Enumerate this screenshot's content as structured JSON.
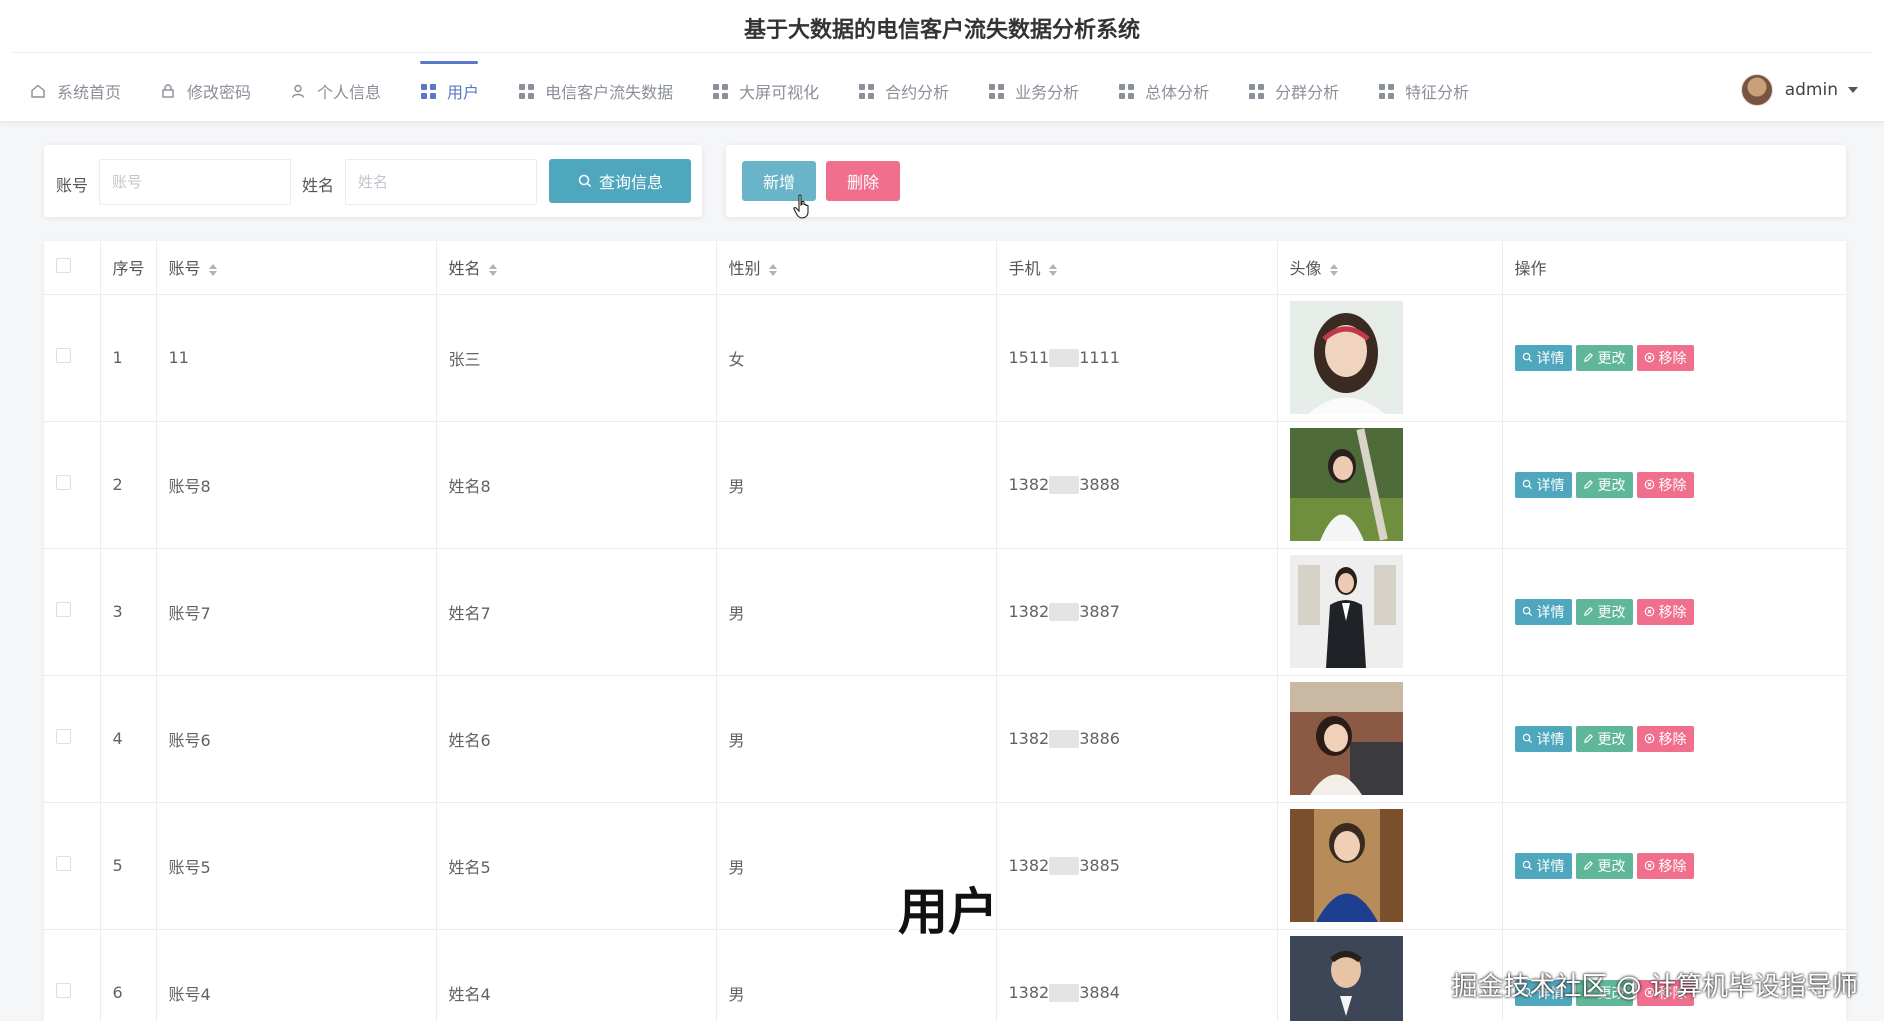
{
  "header": {
    "title": "基于大数据的电信客户流失数据分析系统",
    "user": "admin"
  },
  "nav": [
    {
      "label": "系统首页",
      "icon": "home-icon"
    },
    {
      "label": "修改密码",
      "icon": "lock-icon"
    },
    {
      "label": "个人信息",
      "icon": "user-icon"
    },
    {
      "label": "用户",
      "icon": "grid-icon",
      "active": true
    },
    {
      "label": "电信客户流失数据",
      "icon": "grid-icon"
    },
    {
      "label": "大屏可视化",
      "icon": "grid-icon"
    },
    {
      "label": "合约分析",
      "icon": "grid-icon"
    },
    {
      "label": "业务分析",
      "icon": "grid-icon"
    },
    {
      "label": "总体分析",
      "icon": "grid-icon"
    },
    {
      "label": "分群分析",
      "icon": "grid-icon"
    },
    {
      "label": "特征分析",
      "icon": "grid-icon"
    }
  ],
  "search": {
    "account_label": "账号",
    "account_placeholder": "账号",
    "name_label": "姓名",
    "name_placeholder": "姓名",
    "query_button": "查询信息"
  },
  "actions": {
    "add_button": "新增",
    "delete_button": "删除"
  },
  "table": {
    "columns": [
      "序号",
      "账号",
      "姓名",
      "性别",
      "手机",
      "头像",
      "操作"
    ],
    "row_actions": {
      "detail": "详情",
      "edit": "更改",
      "remove": "移除"
    },
    "rows": [
      {
        "index": "1",
        "account": "11",
        "name": "张三",
        "gender": "女",
        "phone_prefix": "1511",
        "phone_suffix": "1111"
      },
      {
        "index": "2",
        "account": "账号8",
        "name": "姓名8",
        "gender": "男",
        "phone_prefix": "1382",
        "phone_suffix": "3888"
      },
      {
        "index": "3",
        "account": "账号7",
        "name": "姓名7",
        "gender": "男",
        "phone_prefix": "1382",
        "phone_suffix": "3887"
      },
      {
        "index": "4",
        "account": "账号6",
        "name": "姓名6",
        "gender": "男",
        "phone_prefix": "1382",
        "phone_suffix": "3886"
      },
      {
        "index": "5",
        "account": "账号5",
        "name": "姓名5",
        "gender": "男",
        "phone_prefix": "1382",
        "phone_suffix": "3885"
      },
      {
        "index": "6",
        "account": "账号4",
        "name": "姓名4",
        "gender": "男",
        "phone_prefix": "1382",
        "phone_suffix": "3884"
      }
    ]
  },
  "overlay": {
    "caption": "用户",
    "watermark": "掘金技术社区 @ 计算机毕设指导师"
  },
  "colors": {
    "accent": "#5a78c8",
    "query": "#4fa7bd",
    "edit": "#5fb69a",
    "danger": "#ef6f8d"
  }
}
